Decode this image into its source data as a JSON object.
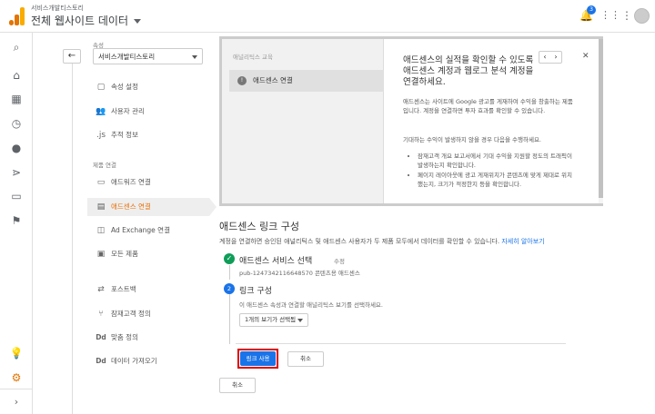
{
  "header": {
    "account_path": "서비스개발티스토리",
    "view_name": "전체 웹사이트 데이터",
    "notification_count": "3"
  },
  "rail": {
    "icons": [
      "search-icon",
      "home-icon",
      "customization-icon",
      "reports-clock-icon",
      "audience-person-icon",
      "acquisition-icon",
      "behavior-icon",
      "conversions-flag-icon"
    ],
    "bottom_icons": [
      "lightbulb-icon",
      "settings-gear-icon"
    ]
  },
  "admin": {
    "property_label": "속성",
    "property_value": "서비스개발티스토리",
    "items": [
      {
        "icon": "▢",
        "label": "속성 설정"
      },
      {
        "icon": "👥",
        "label": "사용자 관리"
      },
      {
        "icon": ".js",
        "label": "추적 정보"
      }
    ],
    "section_label": "제품 연결",
    "product_items": [
      {
        "icon": "▭",
        "label": "애드워즈 연결"
      },
      {
        "icon": "▤",
        "label": "애드센스 연결"
      },
      {
        "icon": "◫",
        "label": "Ad Exchange 연결"
      },
      {
        "icon": "▣",
        "label": "모든 제품"
      }
    ],
    "other_items": [
      {
        "icon": "⇄",
        "label": "포스트백"
      },
      {
        "icon": "⑂",
        "label": "잠재고객 정의"
      },
      {
        "icon": "Dd",
        "label": "맞춤 정의"
      },
      {
        "icon": "Dd",
        "label": "데이터 가져오기"
      }
    ]
  },
  "education": {
    "left_title": "애널리틱스 교육",
    "step_label": "애드센스 연결",
    "title": "애드센스의 실적을 확인할 수 있도록 애드센스 계정과 웹로그 분석 계정을 연결하세요.",
    "para1": "애드센스는 사이트에 Google 광고를 게재하여 수익을 창출하는 제품입니다. 계정을 연결하면 투자 효과를 확인할 수 있습니다.",
    "para2": "기대하는 수익이 발생하지 않을 경우 다음을 수행하세요.",
    "bullets": [
      "잠재고객 개요 보고서에서 기대 수익을 지원할 정도의 트래픽이 발생하는지 확인합니다.",
      "페이지 레이아웃에 광고 게재위치가 콘텐츠에 맞게 제대로 위치했는지, 크기가 적정한지 등을 확인합니다."
    ]
  },
  "main": {
    "title": "애드센스 링크 구성",
    "description": "계정을 연결하면 승인된 애널리틱스 및 애드센스 사용자가 두 제품 모두에서 데이터를 확인할 수 있습니다.",
    "learn_more": "자세히 알아보기",
    "step1_title": "애드센스 서비스 선택",
    "step1_edit": "수정",
    "step1_value": "pub-1247342116648570 콘텐츠용 애드센스",
    "step2_num": "2",
    "step2_title": "링크 구성",
    "step2_desc": "이 애드센스 속성과 연결할 애널리틱스 보기를 선택하세요.",
    "view_select": "1개의 보기가 선택됨",
    "enable_button": "링크 사용",
    "cancel_button": "취소",
    "outer_cancel_button": "취소"
  }
}
